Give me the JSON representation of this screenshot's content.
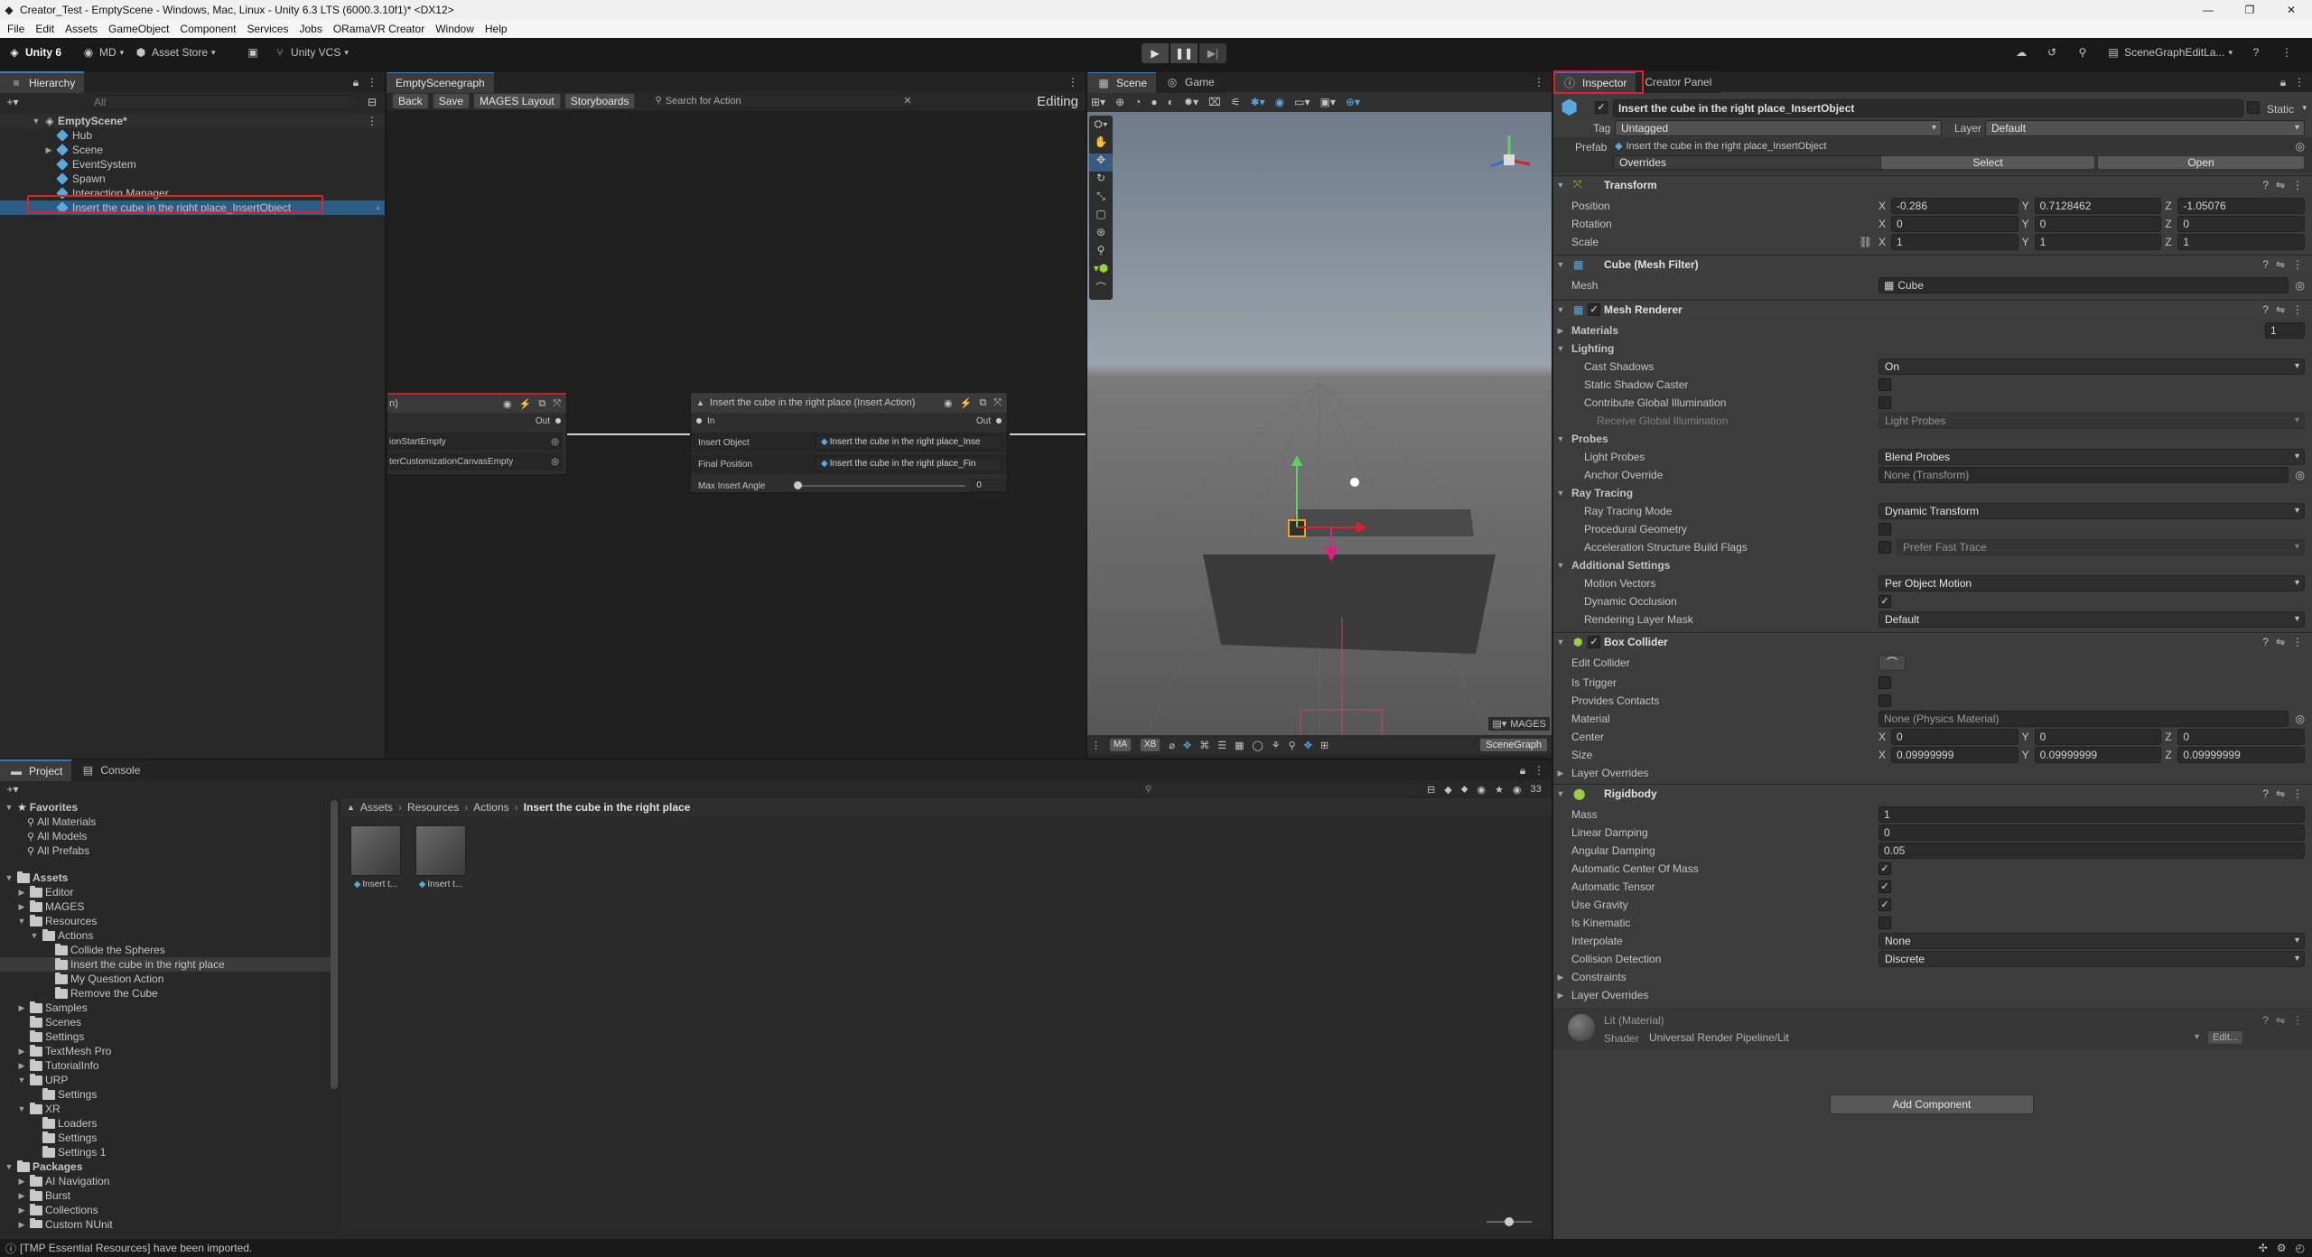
{
  "window": {
    "title": "Creator_Test - EmptyScene - Windows, Mac, Linux - Unity 6.3 LTS (6000.3.10f1)* <DX12>"
  },
  "menu": [
    "File",
    "Edit",
    "Assets",
    "GameObject",
    "Component",
    "Services",
    "Jobs",
    "ORamaVR Creator",
    "Window",
    "Help"
  ],
  "toolbar": {
    "unity": "Unity 6",
    "account": "MD",
    "asset_store": "Asset Store",
    "vcs": "Unity VCS",
    "layout": "SceneGraphEditLa..."
  },
  "hierarchy": {
    "tab": "Hierarchy",
    "search_placeholder": "All",
    "scene": "EmptyScene*",
    "items": [
      "Hub",
      "Scene",
      "EventSystem",
      "Spawn",
      "Interaction Manager",
      "Insert the cube in the right place_InsertObject"
    ]
  },
  "graph": {
    "tab": "EmptyScenegraph",
    "buttons": [
      "Back",
      "Save",
      "MAGES Layout",
      "Storyboards"
    ],
    "search_placeholder": "Search for Action",
    "mode": "Editing",
    "left_node": {
      "title": "n)",
      "out": "Out",
      "fields": [
        "ionStartEmpty",
        "terCustomizationCanvasEmpty"
      ]
    },
    "node": {
      "title": "Insert the cube in the right place (Insert Action)",
      "in": "In",
      "out": "Out",
      "insert_object_label": "Insert Object",
      "insert_object_value": "Insert the cube in the right place_Inse",
      "final_position_label": "Final Position",
      "final_position_value": "Insert the cube in the right place_Fin",
      "max_angle_label": "Max Insert Angle",
      "max_angle_value": "0"
    }
  },
  "scene_view": {
    "tabs": [
      "Scene",
      "Game"
    ],
    "bottom_buttons": [
      "MA",
      "XB"
    ],
    "mages": "MAGES",
    "scenegraph": "SceneGraph"
  },
  "project": {
    "tabs": [
      "Project",
      "Console"
    ],
    "favorites_label": "Favorites",
    "favorites": [
      "All Materials",
      "All Models",
      "All Prefabs"
    ],
    "assets_label": "Assets",
    "tree": [
      {
        "d": 1,
        "t": "Editor",
        "e": "closed"
      },
      {
        "d": 1,
        "t": "MAGES",
        "e": "closed"
      },
      {
        "d": 1,
        "t": "Resources",
        "e": "open"
      },
      {
        "d": 2,
        "t": "Actions",
        "e": "open"
      },
      {
        "d": 3,
        "t": "Collide the Spheres",
        "e": "none"
      },
      {
        "d": 3,
        "t": "Insert the cube in the right place",
        "e": "none",
        "sel": true
      },
      {
        "d": 3,
        "t": "My Question Action",
        "e": "none"
      },
      {
        "d": 3,
        "t": "Remove the Cube",
        "e": "none"
      },
      {
        "d": 1,
        "t": "Samples",
        "e": "closed"
      },
      {
        "d": 1,
        "t": "Scenes",
        "e": "none"
      },
      {
        "d": 1,
        "t": "Settings",
        "e": "none"
      },
      {
        "d": 1,
        "t": "TextMesh Pro",
        "e": "closed"
      },
      {
        "d": 1,
        "t": "TutorialInfo",
        "e": "closed"
      },
      {
        "d": 1,
        "t": "URP",
        "e": "open"
      },
      {
        "d": 2,
        "t": "Settings",
        "e": "none"
      },
      {
        "d": 1,
        "t": "XR",
        "e": "open"
      },
      {
        "d": 2,
        "t": "Loaders",
        "e": "none"
      },
      {
        "d": 2,
        "t": "Settings",
        "e": "none"
      },
      {
        "d": 2,
        "t": "Settings 1",
        "e": "none"
      }
    ],
    "packages_label": "Packages",
    "packages": [
      "AI Navigation",
      "Burst",
      "Collections",
      "Custom NUnit"
    ],
    "breadcrumb": [
      "Assets",
      "Resources",
      "Actions",
      "Insert the cube in the right place"
    ],
    "assets": [
      "Insert t...",
      "Insert t..."
    ],
    "count": "33"
  },
  "status": {
    "message": "[TMP Essential Resources] have been imported."
  },
  "inspector": {
    "tabs": [
      "Inspector",
      "Creator Panel"
    ],
    "object_name": "Insert the cube in the right place_InsertObject",
    "static_label": "Static",
    "tag_label": "Tag",
    "tag": "Untagged",
    "layer_label": "Layer",
    "layer": "Default",
    "prefab_label": "Prefab",
    "prefab": "Insert the cube in the right place_InsertObject",
    "overrides": "Overrides",
    "select": "Select",
    "open": "Open",
    "transform": {
      "title": "Transform",
      "position_label": "Position",
      "position": [
        "-0.286",
        "0.7128462",
        "-1.05076"
      ],
      "rotation_label": "Rotation",
      "rotation": [
        "0",
        "0",
        "0"
      ],
      "scale_label": "Scale",
      "scale": [
        "1",
        "1",
        "1"
      ]
    },
    "mesh_filter": {
      "title": "Cube (Mesh Filter)",
      "mesh_label": "Mesh",
      "mesh": "Cube"
    },
    "mesh_renderer": {
      "title": "Mesh Renderer",
      "materials_label": "Materials",
      "materials_count": "1",
      "lighting_label": "Lighting",
      "cast_shadows_label": "Cast Shadows",
      "cast_shadows": "On",
      "static_shadow_label": "Static Shadow Caster",
      "contribute_gi_label": "Contribute Global Illumination",
      "receive_gi_label": "Receive Global Illumination",
      "receive_gi": "Light Probes",
      "probes_label": "Probes",
      "light_probes_label": "Light Probes",
      "light_probes": "Blend Probes",
      "anchor_label": "Anchor Override",
      "anchor": "None (Transform)",
      "ray_tracing_label": "Ray Tracing",
      "rt_mode_label": "Ray Tracing Mode",
      "rt_mode": "Dynamic Transform",
      "procedural_label": "Procedural Geometry",
      "accel_label": "Acceleration Structure Build Flags",
      "accel": "Prefer Fast Trace",
      "additional_label": "Additional Settings",
      "motion_label": "Motion Vectors",
      "motion": "Per Object Motion",
      "occlusion_label": "Dynamic Occlusion",
      "rendering_layer_label": "Rendering Layer Mask",
      "rendering_layer": "Default"
    },
    "box_collider": {
      "title": "Box Collider",
      "edit_label": "Edit Collider",
      "trigger_label": "Is Trigger",
      "contacts_label": "Provides Contacts",
      "material_label": "Material",
      "material": "None (Physics Material)",
      "center_label": "Center",
      "center": [
        "0",
        "0",
        "0"
      ],
      "size_label": "Size",
      "size": [
        "0.09999999",
        "0.09999999",
        "0.09999999"
      ],
      "layer_overrides": "Layer Overrides"
    },
    "rigidbody": {
      "title": "Rigidbody",
      "mass_label": "Mass",
      "mass": "1",
      "linear_label": "Linear Damping",
      "linear": "0",
      "angular_label": "Angular Damping",
      "angular": "0.05",
      "auto_com_label": "Automatic Center Of Mass",
      "auto_tensor_label": "Automatic Tensor",
      "gravity_label": "Use Gravity",
      "kinematic_label": "Is Kinematic",
      "interpolate_label": "Interpolate",
      "interpolate": "None",
      "collision_label": "Collision Detection",
      "collision": "Discrete",
      "constraints_label": "Constraints",
      "layer_overrides": "Layer Overrides"
    },
    "material": {
      "name": "Lit (Material)",
      "shader_label": "Shader",
      "shader": "Universal Render Pipeline/Lit",
      "edit": "Edit..."
    },
    "add_component": "Add Component"
  },
  "colors": {
    "highlight": "#e0222a",
    "accent": "#3a79bb",
    "cube_blue": "#5aa8dc"
  }
}
